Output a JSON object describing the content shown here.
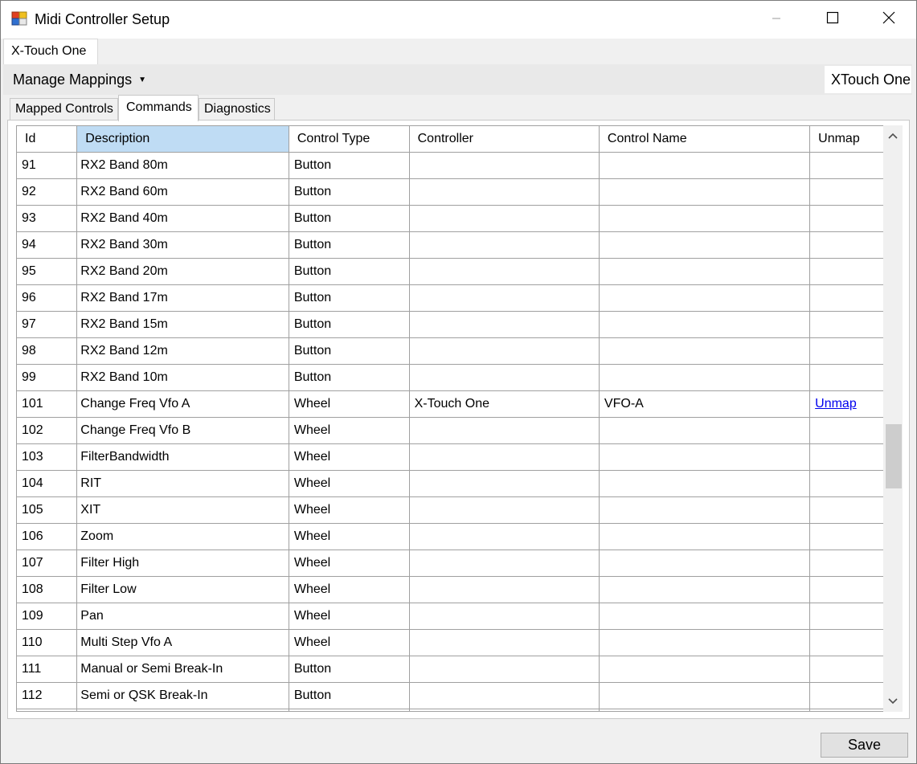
{
  "window": {
    "title": "Midi Controller Setup"
  },
  "top_tab": {
    "label": "X-Touch One"
  },
  "toolbar": {
    "manage_label": "Manage Mappings",
    "device_name": "XTouch One"
  },
  "subtabs": [
    {
      "label": "Mapped Controls"
    },
    {
      "label": "Commands"
    },
    {
      "label": "Diagnostics"
    }
  ],
  "grid": {
    "columns": [
      "Id",
      "Description",
      "Control Type",
      "Controller",
      "Control Name",
      "Unmap"
    ],
    "rows": [
      [
        "91",
        "RX2 Band 80m",
        "Button",
        "",
        "",
        ""
      ],
      [
        "92",
        "RX2 Band 60m",
        "Button",
        "",
        "",
        ""
      ],
      [
        "93",
        "RX2 Band 40m",
        "Button",
        "",
        "",
        ""
      ],
      [
        "94",
        "RX2 Band 30m",
        "Button",
        "",
        "",
        ""
      ],
      [
        "95",
        "RX2 Band 20m",
        "Button",
        "",
        "",
        ""
      ],
      [
        "96",
        "RX2 Band 17m",
        "Button",
        "",
        "",
        ""
      ],
      [
        "97",
        "RX2 Band 15m",
        "Button",
        "",
        "",
        ""
      ],
      [
        "98",
        "RX2 Band 12m",
        "Button",
        "",
        "",
        ""
      ],
      [
        "99",
        "RX2 Band 10m",
        "Button",
        "",
        "",
        ""
      ],
      [
        "101",
        "Change Freq Vfo A",
        "Wheel",
        "X-Touch One",
        "VFO-A",
        "Unmap"
      ],
      [
        "102",
        "Change Freq Vfo B",
        "Wheel",
        "",
        "",
        ""
      ],
      [
        "103",
        "FilterBandwidth",
        "Wheel",
        "",
        "",
        ""
      ],
      [
        "104",
        "RIT",
        "Wheel",
        "",
        "",
        ""
      ],
      [
        "105",
        "XIT",
        "Wheel",
        "",
        "",
        ""
      ],
      [
        "106",
        "Zoom",
        "Wheel",
        "",
        "",
        ""
      ],
      [
        "107",
        "Filter High",
        "Wheel",
        "",
        "",
        ""
      ],
      [
        "108",
        "Filter Low",
        "Wheel",
        "",
        "",
        ""
      ],
      [
        "109",
        "Pan",
        "Wheel",
        "",
        "",
        ""
      ],
      [
        "110",
        "Multi Step Vfo A",
        "Wheel",
        "",
        "",
        ""
      ],
      [
        "111",
        "Manual or Semi Break-In",
        "Button",
        "",
        "",
        ""
      ],
      [
        "112",
        "Semi or QSK Break-In",
        "Button",
        "",
        "",
        ""
      ],
      [
        "",
        "",
        "",
        "",
        "",
        ""
      ]
    ]
  },
  "footer": {
    "save_label": "Save"
  },
  "icons": {
    "app": "midi-app-icon",
    "minimize": "minimize-icon",
    "maximize": "maximize-icon",
    "close": "close-icon",
    "dropdown": "caret-down-icon",
    "scroll_up": "chevron-up-icon",
    "scroll_down": "chevron-down-icon"
  },
  "colors": {
    "selected_header": "#bfdcf4",
    "link": "#0000ee",
    "grid_line": "#a0a0a0"
  }
}
